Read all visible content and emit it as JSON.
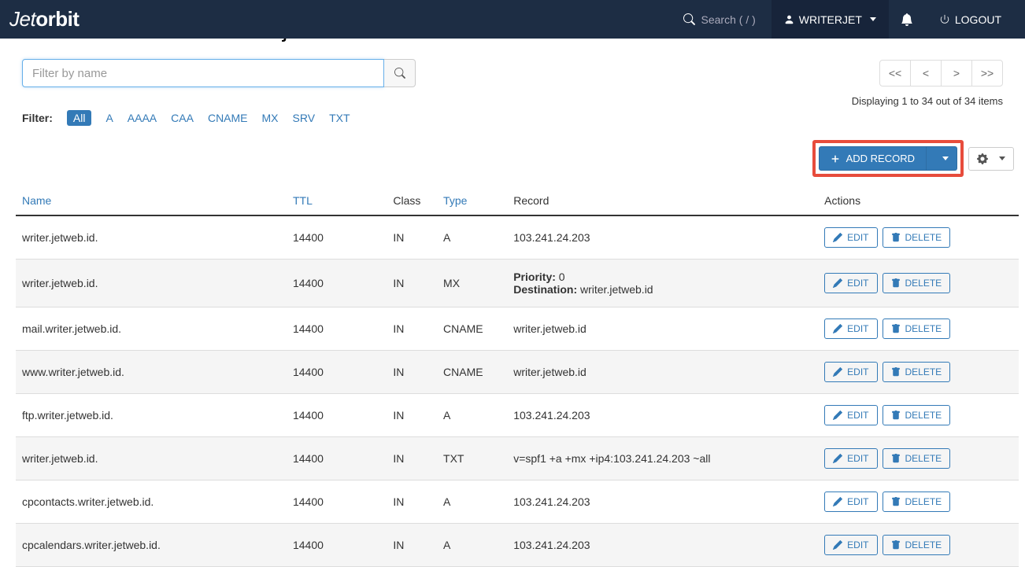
{
  "nav": {
    "logo_part1": "Jet",
    "logo_part2": "orbit",
    "search_label": "Search ( / )",
    "user": "WRITERJET",
    "logout": "LOGOUT"
  },
  "page_title": "Zone Records for \"writer.jetweb.id\"",
  "filter": {
    "placeholder": "Filter by name",
    "label": "Filter:",
    "types": [
      "All",
      "A",
      "AAAA",
      "CAA",
      "CNAME",
      "MX",
      "SRV",
      "TXT"
    ],
    "active": "All"
  },
  "pager": {
    "first": "<<",
    "prev": "<",
    "next": ">",
    "last": ">>",
    "display": "Displaying 1 to 34 out of 34 items"
  },
  "add_button": "ADD RECORD",
  "columns": {
    "name": "Name",
    "ttl": "TTL",
    "class": "Class",
    "type": "Type",
    "record": "Record",
    "actions": "Actions"
  },
  "buttons": {
    "edit": "EDIT",
    "delete": "DELETE"
  },
  "record_labels": {
    "priority": "Priority:",
    "destination": "Destination:"
  },
  "rows": [
    {
      "name": "writer.jetweb.id.",
      "ttl": "14400",
      "class": "IN",
      "type": "A",
      "record": "103.241.24.203"
    },
    {
      "name": "writer.jetweb.id.",
      "ttl": "14400",
      "class": "IN",
      "type": "MX",
      "priority": "0",
      "destination": "writer.jetweb.id"
    },
    {
      "name": "mail.writer.jetweb.id.",
      "ttl": "14400",
      "class": "IN",
      "type": "CNAME",
      "record": "writer.jetweb.id"
    },
    {
      "name": "www.writer.jetweb.id.",
      "ttl": "14400",
      "class": "IN",
      "type": "CNAME",
      "record": "writer.jetweb.id"
    },
    {
      "name": "ftp.writer.jetweb.id.",
      "ttl": "14400",
      "class": "IN",
      "type": "A",
      "record": "103.241.24.203"
    },
    {
      "name": "writer.jetweb.id.",
      "ttl": "14400",
      "class": "IN",
      "type": "TXT",
      "record": "v=spf1 +a +mx +ip4:103.241.24.203 ~all"
    },
    {
      "name": "cpcontacts.writer.jetweb.id.",
      "ttl": "14400",
      "class": "IN",
      "type": "A",
      "record": "103.241.24.203"
    },
    {
      "name": "cpcalendars.writer.jetweb.id.",
      "ttl": "14400",
      "class": "IN",
      "type": "A",
      "record": "103.241.24.203"
    }
  ]
}
